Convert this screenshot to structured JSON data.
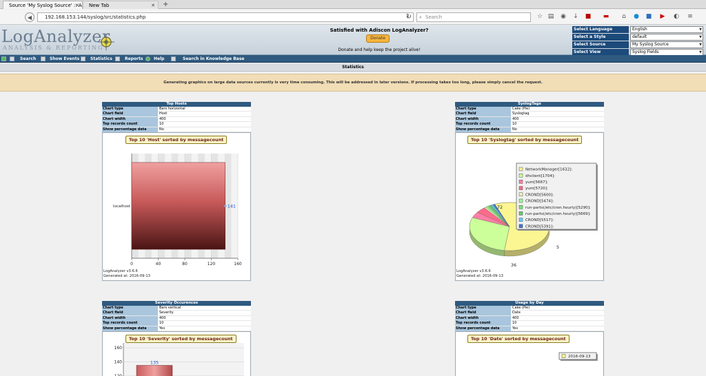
{
  "browser": {
    "tabs": [
      {
        "title": "Source 'My Syslog Source' :: Adi..."
      },
      {
        "title": "New Tab"
      }
    ],
    "new_tab": "+",
    "url": "192.168.153.144/syslog/src/statistics.php",
    "search_placeholder": "Search"
  },
  "header": {
    "logo_main": "LogAnalyzer",
    "logo_sub": "ANALYSIS & REPORTING",
    "donate_title": "Satisfied with Adiscon LogAnalyzer?",
    "donate_button": "Donate",
    "donate_text": "Donate and help keep the project alive!",
    "selectors": [
      {
        "label": "Select Language",
        "value": "English"
      },
      {
        "label": "Select a Style",
        "value": "default"
      },
      {
        "label": "Select Source",
        "value": "My Syslog Source"
      },
      {
        "label": "Select View",
        "value": "Syslog Fields"
      }
    ]
  },
  "menu": [
    {
      "label": "Search"
    },
    {
      "label": "Show Events"
    },
    {
      "label": "Statistics"
    },
    {
      "label": "Reports"
    },
    {
      "label": "Help"
    },
    {
      "label": "Search in Knowledge Base"
    }
  ],
  "page": {
    "title": "Statistics",
    "warning": "Generating graphics on large data sources currently is very time consuming. This will be addressed in later versions. If processing takes too long, please simply cancel the request."
  },
  "panels": [
    {
      "heading": "Top Hosts",
      "props": [
        {
          "label": "Chart type",
          "value": "Bars horizontal"
        },
        {
          "label": "Chart field",
          "value": "Host"
        },
        {
          "label": "Chart width",
          "value": "400"
        },
        {
          "label": "Top records count",
          "value": "10"
        },
        {
          "label": "Show percentage data",
          "value": "No"
        }
      ],
      "caption": "Top 10 'Host' sorted by messagecount",
      "footer_version": "LogAnalyzer v3.6.6",
      "footer_generated": "Generated at: 2016-09-13"
    },
    {
      "heading": "SyslogTags",
      "props": [
        {
          "label": "Chart type",
          "value": "Cake (Pie)"
        },
        {
          "label": "Chart field",
          "value": "Syslogtag"
        },
        {
          "label": "Chart width",
          "value": "400"
        },
        {
          "label": "Top records count",
          "value": "10"
        },
        {
          "label": "Show percentage data",
          "value": "No"
        }
      ],
      "caption": "Top 10 'Syslogtag' sorted by messagecount",
      "footer_version": "LogAnalyzer v3.6.6",
      "footer_generated": "Generated at: 2016-09-13"
    },
    {
      "heading": "Severity Occurences",
      "props": [
        {
          "label": "Chart type",
          "value": "Bars vertical"
        },
        {
          "label": "Chart field",
          "value": "Severity"
        },
        {
          "label": "Chart width",
          "value": "400"
        },
        {
          "label": "Top records count",
          "value": "10"
        },
        {
          "label": "Show percentage data",
          "value": "Yes"
        }
      ],
      "caption": "Top 10 'Severity' sorted by messagecount"
    },
    {
      "heading": "Usage by Day",
      "props": [
        {
          "label": "Chart type",
          "value": "Cake (Pie)"
        },
        {
          "label": "Chart field",
          "value": "Date"
        },
        {
          "label": "Chart width",
          "value": "400"
        },
        {
          "label": "Top records count",
          "value": "10"
        },
        {
          "label": "Show percentage data",
          "value": "Yes"
        }
      ],
      "caption": "Top 10 'Date' sorted by messagecount"
    }
  ],
  "chart_data": [
    {
      "type": "bar",
      "orientation": "horizontal",
      "categories": [
        "localhost"
      ],
      "values": [
        141
      ],
      "xlim": [
        0,
        160
      ],
      "xticks": [
        0,
        40,
        80,
        120,
        160
      ],
      "data_labels": [
        "141"
      ],
      "bar_color": "#d9a0a0"
    },
    {
      "type": "pie",
      "slices": [
        {
          "label": "NetworkManager[1632]:",
          "value": 72,
          "color": "#fbf592"
        },
        {
          "label": "dhclient[1704]:",
          "value": 36,
          "color": "#ccff99"
        },
        {
          "label": "yum[5667]:",
          "value": 5,
          "color": "#ff7fa6"
        },
        {
          "label": "yum[5720]:",
          "value": 5,
          "color": "#ff6b8a"
        },
        {
          "label": "CROND[5600]:",
          "value": 1,
          "color": "#f0f0c0"
        },
        {
          "label": "CROND[5474]:",
          "value": 1,
          "color": "#99ff99"
        },
        {
          "label": "run-parts(/etc/cron.hourly)[5290]:",
          "value": 1,
          "color": "#7fe07f"
        },
        {
          "label": "run-parts(/etc/cron.hourly)[5669]:",
          "value": 1,
          "color": "#66cc66"
        },
        {
          "label": "CROND[5517]:",
          "value": 1,
          "color": "#66ccff"
        },
        {
          "label": "CROND[5391]:",
          "value": 1,
          "color": "#4477cc"
        }
      ],
      "visible_labels": [
        "72",
        "36",
        "5"
      ],
      "legend": "top-right"
    },
    {
      "type": "bar",
      "orientation": "vertical",
      "yticks": [
        120,
        140,
        160
      ],
      "data_labels": [
        "135"
      ],
      "values": [
        135
      ],
      "ylim": [
        110,
        165
      ]
    },
    {
      "type": "pie",
      "slices": [
        {
          "label": "2016-09-13",
          "value": 1,
          "color": "#fbf592"
        }
      ],
      "legend": "top-right"
    }
  ]
}
